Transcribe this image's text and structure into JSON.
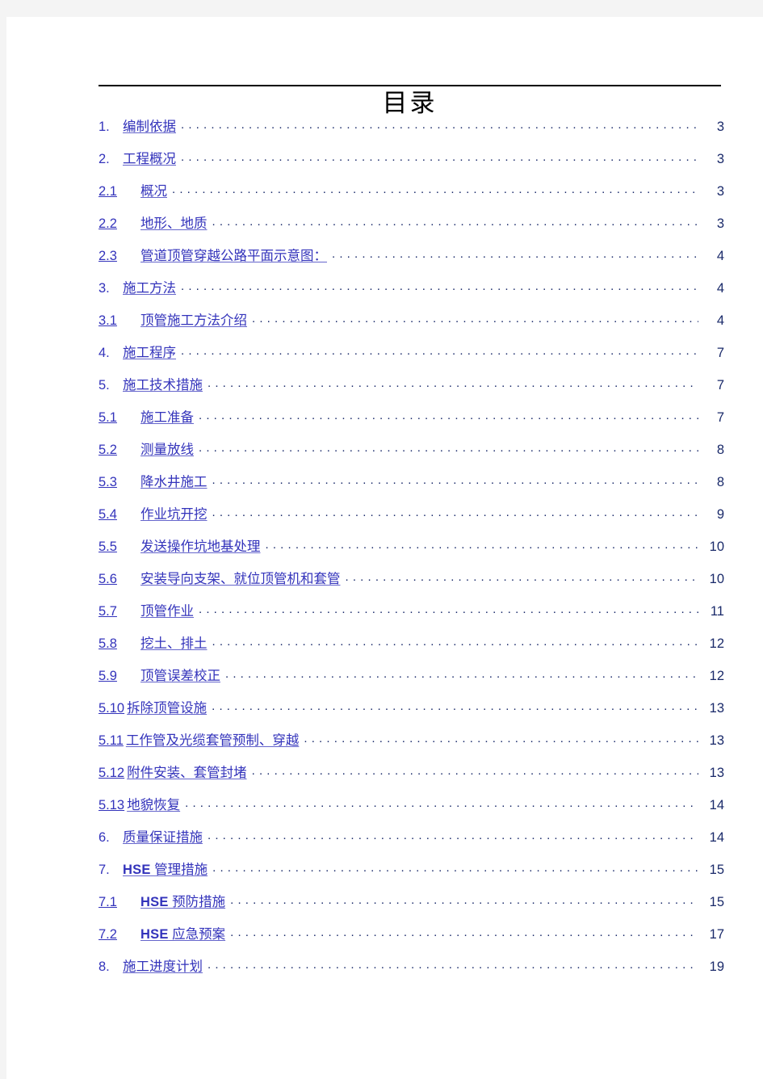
{
  "document": {
    "title": "目录",
    "accent_color": "#3333bb",
    "leader_color": "#1a2a6a",
    "rule_color": "#000000",
    "page_background": "#ffffff",
    "canvas_background": "#f4f4f4"
  },
  "toc": {
    "entries": [
      {
        "number": "1.",
        "label": "编制依据",
        "page": "3",
        "level": 1
      },
      {
        "number": "2.",
        "label": "工程概况",
        "page": "3",
        "level": 1
      },
      {
        "number": "2.1",
        "label": "概况",
        "page": "3",
        "level": 2
      },
      {
        "number": "2.2",
        "label": "地形、地质",
        "page": "3",
        "level": 2
      },
      {
        "number": "2.3",
        "label": "管道顶管穿越公路平面示意图：",
        "page": "4",
        "level": 2
      },
      {
        "number": "3.",
        "label": "施工方法",
        "page": "4",
        "level": 1
      },
      {
        "number": "3.1",
        "label": "顶管施工方法介绍",
        "page": "4",
        "level": 2
      },
      {
        "number": "4.",
        "label": "施工程序",
        "page": "7",
        "level": 1
      },
      {
        "number": "5.",
        "label": "施工技术措施",
        "page": "7",
        "level": 1
      },
      {
        "number": "5.1",
        "label": "施工准备",
        "page": "7",
        "level": 2
      },
      {
        "number": "5.2",
        "label": "测量放线",
        "page": "8",
        "level": 2
      },
      {
        "number": "5.3",
        "label": "降水井施工",
        "page": "8",
        "level": 2
      },
      {
        "number": "5.4",
        "label": "作业坑开挖",
        "page": "9",
        "level": 2
      },
      {
        "number": "5.5",
        "label": "发送操作坑地基处理",
        "page": "10",
        "level": 2
      },
      {
        "number": "5.6",
        "label": "安装导向支架、就位顶管机和套管",
        "page": "10",
        "level": 2
      },
      {
        "number": "5.7",
        "label": "顶管作业",
        "page": "11",
        "level": 2
      },
      {
        "number": "5.8",
        "label": "挖土、排土",
        "page": "12",
        "level": 2
      },
      {
        "number": "5.9",
        "label": "顶管误差校正",
        "page": "12",
        "level": 2
      },
      {
        "number": "5.10",
        "label": "拆除顶管设施",
        "page": "13",
        "level": 2,
        "wide": true
      },
      {
        "number": "5.11",
        "label": "工作管及光缆套管预制、穿越",
        "page": "13",
        "level": 2,
        "wide": true
      },
      {
        "number": "5.12",
        "label": "附件安装、套管封堵",
        "page": "13",
        "level": 2,
        "wide": true
      },
      {
        "number": "5.13",
        "label": "地貌恢复",
        "page": "14",
        "level": 2,
        "wide": true
      },
      {
        "number": "6.",
        "label": "质量保证措施",
        "page": "14",
        "level": 1
      },
      {
        "number": "7.",
        "label": "HSE 管理措施",
        "page": "15",
        "level": 1
      },
      {
        "number": "7.1",
        "label": "HSE 预防措施",
        "page": "15",
        "level": 2
      },
      {
        "number": "7.2",
        "label": "HSE 应急预案",
        "page": "17",
        "level": 2
      },
      {
        "number": "8.",
        "label": "施工进度计划",
        "page": "19",
        "level": 1
      }
    ]
  }
}
